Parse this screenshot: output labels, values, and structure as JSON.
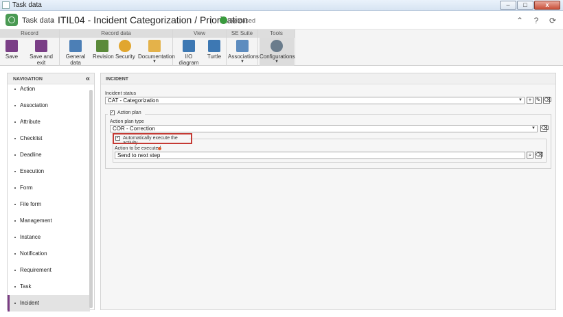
{
  "window": {
    "title": "Task data",
    "controls": [
      "–",
      "□",
      "x"
    ]
  },
  "header": {
    "breadcrumb_root": "Task data",
    "breadcrumb_separator": "›",
    "title": "ITIL04 - Incident Categorization / Priorization",
    "status": "Released",
    "icons": [
      "collapse-up-icon",
      "help-icon",
      "refresh-icon"
    ],
    "icon_glyphs": [
      "⌃",
      "?",
      "⟳"
    ]
  },
  "ribbon": {
    "groups": [
      {
        "title": "Record",
        "buttons": [
          {
            "label": "Save",
            "icon": "save-icon"
          },
          {
            "label": "Save and exit",
            "icon": "save-exit-icon"
          }
        ]
      },
      {
        "title": "Record data",
        "buttons": [
          {
            "label": "General data",
            "icon": "general-data-icon"
          },
          {
            "label": "Revision",
            "icon": "revision-icon"
          },
          {
            "label": "Security",
            "icon": "key-icon"
          },
          {
            "label": "Documentation",
            "icon": "folder-icon"
          }
        ]
      },
      {
        "title": "View",
        "buttons": [
          {
            "label": "I/O diagram",
            "icon": "io-diagram-icon"
          },
          {
            "label": "Turtle",
            "icon": "turtle-icon"
          }
        ]
      },
      {
        "title": "SE Suite",
        "buttons": [
          {
            "label": "Associations",
            "icon": "associations-icon"
          }
        ]
      },
      {
        "title": "Tools",
        "buttons": [
          {
            "label": "Configurations",
            "icon": "gears-icon"
          }
        ]
      }
    ]
  },
  "navigation": {
    "title": "NAVIGATION",
    "collapse_glyph": "«",
    "items": [
      "Action",
      "Association",
      "Attribute",
      "Checklist",
      "Deadline",
      "Execution",
      "Form",
      "File form",
      "Management",
      "Instance",
      "Notification",
      "Requirement",
      "Task",
      "Incident"
    ],
    "selected": "Incident"
  },
  "incident": {
    "section_title": "INCIDENT",
    "incident_status_label": "Incident status",
    "incident_status_value": "CAT - Categorization",
    "action_plan_label": "Action plan",
    "action_plan_checked": true,
    "action_plan_type_label": "Action plan type",
    "action_plan_type_value": "COR - Correction",
    "auto_execute_label": "Automatically execute the activity",
    "auto_execute_checked": true,
    "action_to_execute_label": "Action to be executed",
    "action_to_execute_value": "Send to next step"
  },
  "colors": {
    "accent_purple": "#7b3d84",
    "highlight_red": "#c53a34",
    "status_green": "#3a9a3e",
    "required_orange": "#e05b2e"
  }
}
